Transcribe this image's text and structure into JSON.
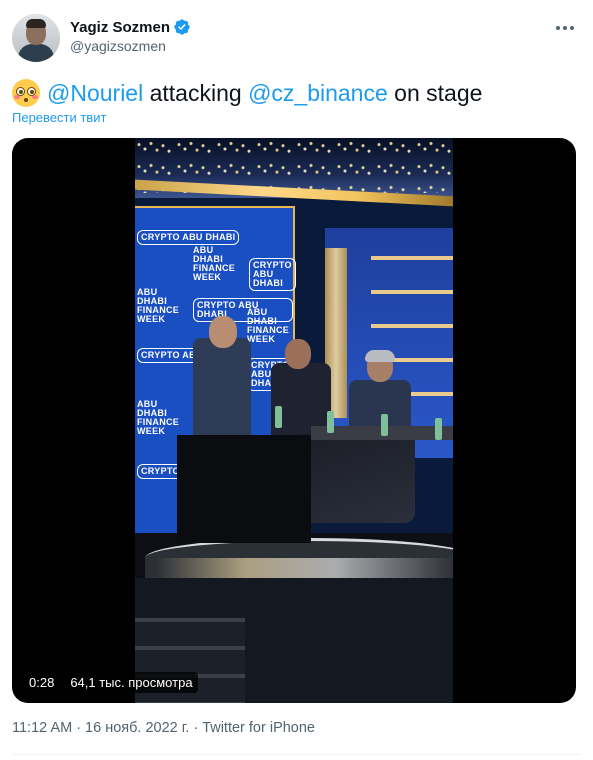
{
  "author": {
    "name": "Yagiz Sozmen",
    "handle": "@yagizsozmen",
    "verified": true
  },
  "tweet": {
    "emoji": "flushed-face",
    "mention_1": "@Nouriel",
    "text_1": " attacking ",
    "mention_2": "@cz_binance",
    "text_2": " on stage"
  },
  "translate_label": "Перевести твит",
  "video": {
    "duration": "0:28",
    "views": "64,1 тыс. просмотра",
    "backdrop_logos": [
      "CRYPTO ABU DHABI",
      "ABU DHABI FINANCE WEEK"
    ]
  },
  "meta": {
    "time": "11:12 AM",
    "separator": "·",
    "date": "16 нояб. 2022 г.",
    "source": "Twitter for iPhone"
  },
  "colors": {
    "accent": "#1d9bf0",
    "text": "#0f1419",
    "secondary": "#536471"
  }
}
